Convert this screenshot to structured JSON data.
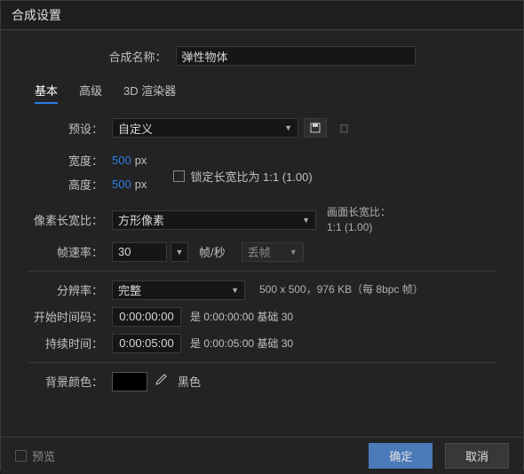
{
  "dialog": {
    "title": "合成设置",
    "name_label": "合成名称：",
    "name_value": "弹性物体"
  },
  "tabs": {
    "basic": "基本",
    "advanced": "高级",
    "renderer": "3D 渲染器"
  },
  "preset": {
    "label": "预设：",
    "value": "自定义"
  },
  "dims": {
    "width_label": "宽度：",
    "width_value": "500",
    "height_label": "高度：",
    "height_value": "500",
    "px": "px",
    "lock_label": "锁定长宽比为 1:1 (1.00)"
  },
  "par": {
    "label": "像素长宽比：",
    "value": "方形像素",
    "frame_ar_label": "画面长宽比：",
    "frame_ar_value": "1:1 (1.00)"
  },
  "fps": {
    "label": "帧速率：",
    "value": "30",
    "unit": "帧/秒",
    "drop_label": "丢帧"
  },
  "res": {
    "label": "分辨率：",
    "value": "完整",
    "info": "500 x 500，976 KB（每 8bpc 帧）"
  },
  "time": {
    "start_label": "开始时间码：",
    "start_value": "0:00:00:00",
    "start_info": "是 0:00:00:00 基础 30",
    "dur_label": "持续时间：",
    "dur_value": "0:00:05:00",
    "dur_info": "是 0:00:05:00 基础 30"
  },
  "bg": {
    "label": "背景颜色：",
    "name": "黑色"
  },
  "footer": {
    "preview": "预览",
    "ok": "确定",
    "cancel": "取消"
  }
}
